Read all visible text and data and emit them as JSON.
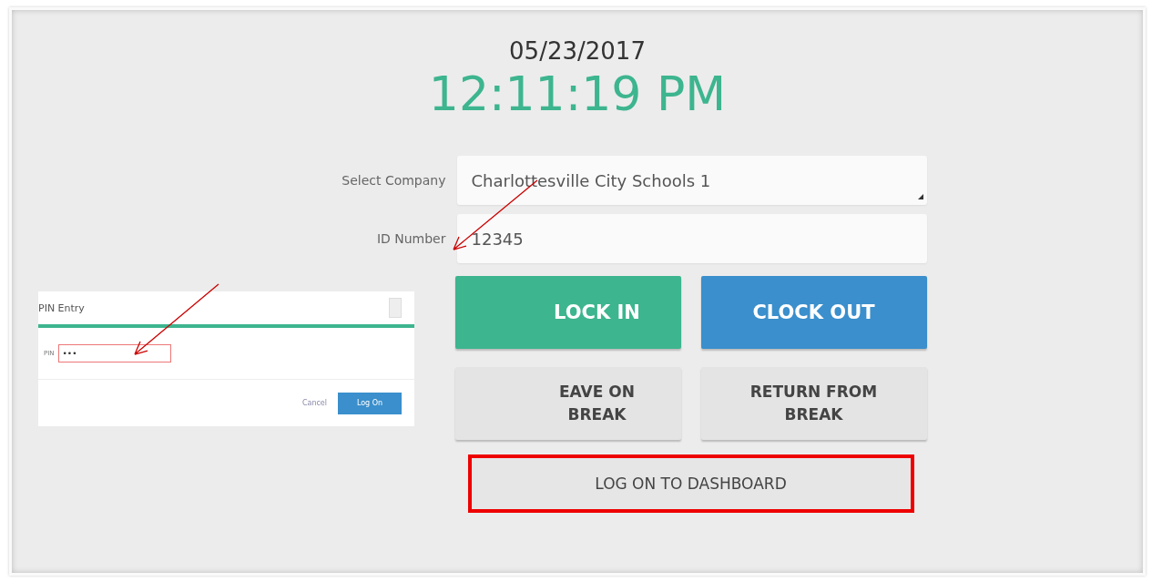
{
  "date": "05/23/2017",
  "time": "12:11:19 PM",
  "fields": [
    {
      "kind": "select",
      "label": "Select Company",
      "value": "Charlottesville City Schools  1"
    },
    {
      "kind": "text",
      "label": "ID Number",
      "value": "12345"
    }
  ],
  "buttons": [
    {
      "kind": "green",
      "lines": [
        "LOCK IN"
      ]
    },
    {
      "kind": "blue",
      "lines": [
        "CLOCK OUT"
      ]
    },
    {
      "kind": "grey",
      "lines": [
        "EAVE ON",
        "BREAK"
      ]
    },
    {
      "kind": "grey",
      "lines": [
        "RETURN FROM",
        "BREAK"
      ]
    }
  ],
  "dashboard_button": {
    "label": "LOG ON TO DASHBOARD",
    "highlighted": true
  },
  "pin_dialog": {
    "title": "PIN Entry",
    "pin_label": "PIN",
    "pin_value": "•••",
    "cancel": "Cancel",
    "submit": "Log On"
  }
}
